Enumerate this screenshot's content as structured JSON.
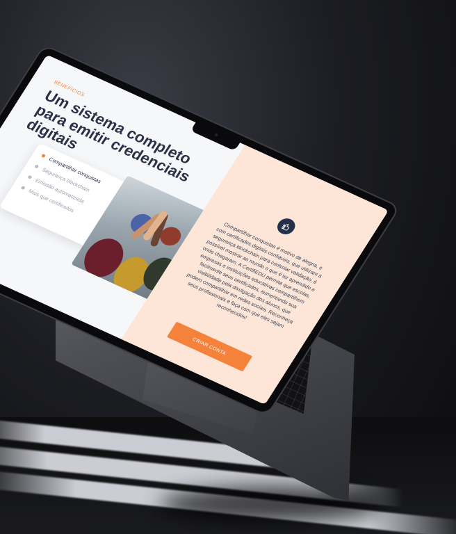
{
  "page": {
    "eyebrow": "BENEFÍCIOS",
    "title": "Um sistema completo para emitir credenciais digitais"
  },
  "features": [
    {
      "label": "Compartilhar conquistas",
      "active": true
    },
    {
      "label": "Segurança blockchain",
      "active": false
    },
    {
      "label": "Emissão automatizada",
      "active": false
    },
    {
      "label": "Mais que certificados",
      "active": false
    }
  ],
  "panel": {
    "icon": "thumbs-up-icon",
    "body": "Compartilhar conquistas é motivo de alegria, e com certificados digitais confiáveis, que utilizam a segurança blockchain para controlar validação, é possível mostrar ao mundo o que é ter aprendido e onde chegaram. A CertifiEDU permite que escolas, empresas e instituições educativas compartilhem facilmente seus certificados, aumentando sua visibilidade pela divulgação dos alunos, que podem compartilhar em redes sociais. Reconheça seus profissionais e faça com que eles sejam reconhecidos!",
    "cta_label": "CRIAR CONTA"
  },
  "colors": {
    "accent": "#f5823a",
    "peach": "#fde6d8",
    "navy": "#23304a"
  }
}
